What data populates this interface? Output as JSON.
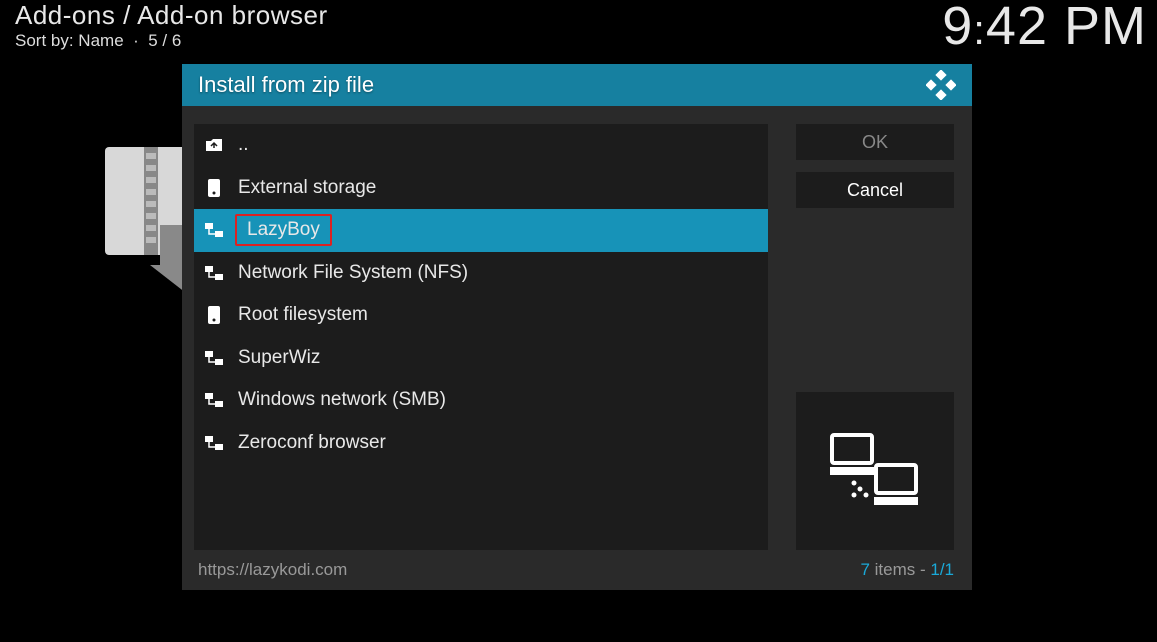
{
  "header": {
    "breadcrumb": "Add-ons / Add-on browser",
    "sort_label": "Sort by: Name",
    "sort_separator": "·",
    "sort_index": "5 / 6"
  },
  "clock": {
    "hour": "9",
    "minute": "42",
    "ampm": "PM"
  },
  "dialog": {
    "title": "Install from zip file",
    "ok_label": "OK",
    "cancel_label": "Cancel"
  },
  "files": {
    "up": "..",
    "external": "External storage",
    "lazyboy": "LazyBoy",
    "nfs": "Network File System (NFS)",
    "root": "Root filesystem",
    "superwiz": "SuperWiz",
    "smb": "Windows network (SMB)",
    "zeroconf": "Zeroconf browser"
  },
  "footer": {
    "url": "https://lazykodi.com",
    "count": "7",
    "items_word": " items - ",
    "page": "1/1"
  }
}
